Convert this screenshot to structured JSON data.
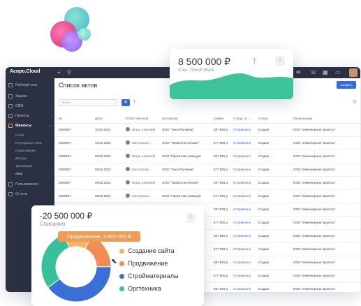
{
  "app": {
    "brand": "Аспро.Cloud",
    "topbar_icons": [
      "plus-icon",
      "search-icon"
    ],
    "right_icons": [
      "mail-icon",
      "phone-icon",
      "calendar-icon",
      "chat-icon"
    ]
  },
  "sidebar": {
    "items": [
      {
        "label": "Рабочий стол",
        "icon": "desktop-icon"
      },
      {
        "label": "Задачи",
        "icon": "tasks-icon"
      },
      {
        "label": "CRM",
        "icon": "crm-icon"
      },
      {
        "label": "Проекты",
        "icon": "projects-icon"
      },
      {
        "label": "Финансы",
        "icon": "finance-icon"
      }
    ],
    "finance_sub": [
      "Счета",
      "Регулярные счета",
      "Предложения",
      "Доходы",
      "Транзакции",
      "Акты"
    ],
    "bottom": [
      {
        "label": "Пользователи",
        "icon": "users-icon"
      },
      {
        "label": "Отчеты",
        "icon": "reports-icon"
      }
    ]
  },
  "main": {
    "title": "Список актов",
    "create_label": "Создать",
    "search_placeholder": "Поиск",
    "columns": [
      "№",
      "Дата",
      "Ответственный",
      "Контрагент",
      "Сумма",
      "Статус от...",
      "Статус",
      "Организация"
    ],
    "rows": [
      {
        "num": "2000967",
        "date": "10.02.2022",
        "owner": "Игорь Алексеев",
        "partner": "ООО \"ТехноПолимер\"",
        "sum": "397 800 р.",
        "status_sent": "Отправлено",
        "status": "Создан",
        "org": "ООО \"Инженерные проекты\""
      },
      {
        "num": "2000967",
        "date": "10.02.2022",
        "owner": "Константин ...",
        "partner": "ООО \"Термостатические\"",
        "sum": "677 800 р.",
        "status_sent": "Отправлено",
        "status": "Создан",
        "org": "ООО \"Инженерные проекты\""
      },
      {
        "num": "2000967",
        "date": "09.02.2022",
        "owner": "Игорь Алексеев",
        "partner": "ООО \"Проектная команда\"",
        "sum": "397 800 р.",
        "status_sent": "Отправлено",
        "status": "Создан",
        "org": "ООО \"Инженерные проекты\""
      },
      {
        "num": "2000967",
        "date": "09.02.2022",
        "owner": "Константин ...",
        "partner": "ООО \"ТехноПолимер\"",
        "sum": "677 800 р.",
        "status_sent": "Отправлено",
        "status": "Создан",
        "org": "ООО \"Инженерные проекты\""
      },
      {
        "num": "2000967",
        "date": "09.02.2022",
        "owner": "Игорь Алексеев",
        "partner": "ООО \"Термостатические\"",
        "sum": "397 800 р.",
        "status_sent": "Отправлено",
        "status": "Создан",
        "org": "ООО \"Инженерные проекты\""
      },
      {
        "num": "2000967",
        "date": "09.02.2022",
        "owner": "Константин ...",
        "partner": "ООО \"Проектная команда\"",
        "sum": "677 800 р.",
        "status_sent": "Отправлено",
        "status": "Создан",
        "org": "ООО \"Инженерные проекты\""
      },
      {
        "num": "2000967",
        "date": "08.02.2022",
        "owner": "Игорь Алексеев",
        "partner": "ООО \"ТехноПолимер\"",
        "sum": "397 800 р.",
        "status_sent": "Отправлено",
        "status": "Создан",
        "org": "ООО \"Инженерные проекты\""
      },
      {
        "num": "2000967",
        "date": "08.02.2022",
        "owner": "",
        "partner": "",
        "sum": "677 800 р.",
        "status_sent": "Отправлено",
        "status": "Создан",
        "org": "ООО \"Инженерные проекты\""
      },
      {
        "num": "",
        "date": "",
        "owner": "",
        "partner": "",
        "sum": "397 800 р.",
        "status_sent": "Отправлено",
        "status": "Создан",
        "org": "ООО \"Инженерные проекты\""
      },
      {
        "num": "",
        "date": "",
        "owner": "",
        "partner": "",
        "sum": "677 800 р.",
        "status_sent": "Отправлено",
        "status": "Создан",
        "org": "ООО \"Инженерные проекты\""
      },
      {
        "num": "",
        "date": "",
        "owner": "",
        "partner": "",
        "sum": "397 800 р.",
        "status_sent": "Отправлено",
        "status": "Создан",
        "org": "ООО \"Инженерные проекты\""
      },
      {
        "num": "",
        "date": "",
        "owner": "",
        "partner": "",
        "sum": "677 800 р.",
        "status_sent": "Отправлено",
        "status": "Создан",
        "org": "ООО \"Инженерные проекты\""
      },
      {
        "num": "",
        "date": "",
        "owner": "",
        "partner": "",
        "sum": "397 800 р.",
        "status_sent": "Отправлено",
        "status": "Создан",
        "org": "ООО \"Инженерные проекты\""
      }
    ]
  },
  "balance_card": {
    "amount": "8 500 000 ₽",
    "arrow": "↑",
    "label": "Счет Tinkoff Bank",
    "accent": "#3cc59a"
  },
  "expense_card": {
    "amount": "-20 500 000 ₽",
    "label": "Списания",
    "tooltip": "Продвижение: 3 600 000 ₽",
    "legend": [
      {
        "label": "Создание сайта",
        "color": "#f7b267"
      },
      {
        "label": "Продвижение",
        "color": "#f28c55"
      },
      {
        "label": "Стройматериалы",
        "color": "#3b6fd8"
      },
      {
        "label": "Оргтехника",
        "color": "#36c19a"
      }
    ],
    "slices": [
      {
        "name": "Создание сайта",
        "value": 13,
        "color": "#f7b267"
      },
      {
        "name": "Продвижение",
        "value": 17.5,
        "color": "#f28c55"
      },
      {
        "name": "Стройматериалы",
        "value": 40,
        "color": "#3b6fd8"
      },
      {
        "name": "Оргтехника",
        "value": 29.5,
        "color": "#36c19a"
      }
    ]
  }
}
